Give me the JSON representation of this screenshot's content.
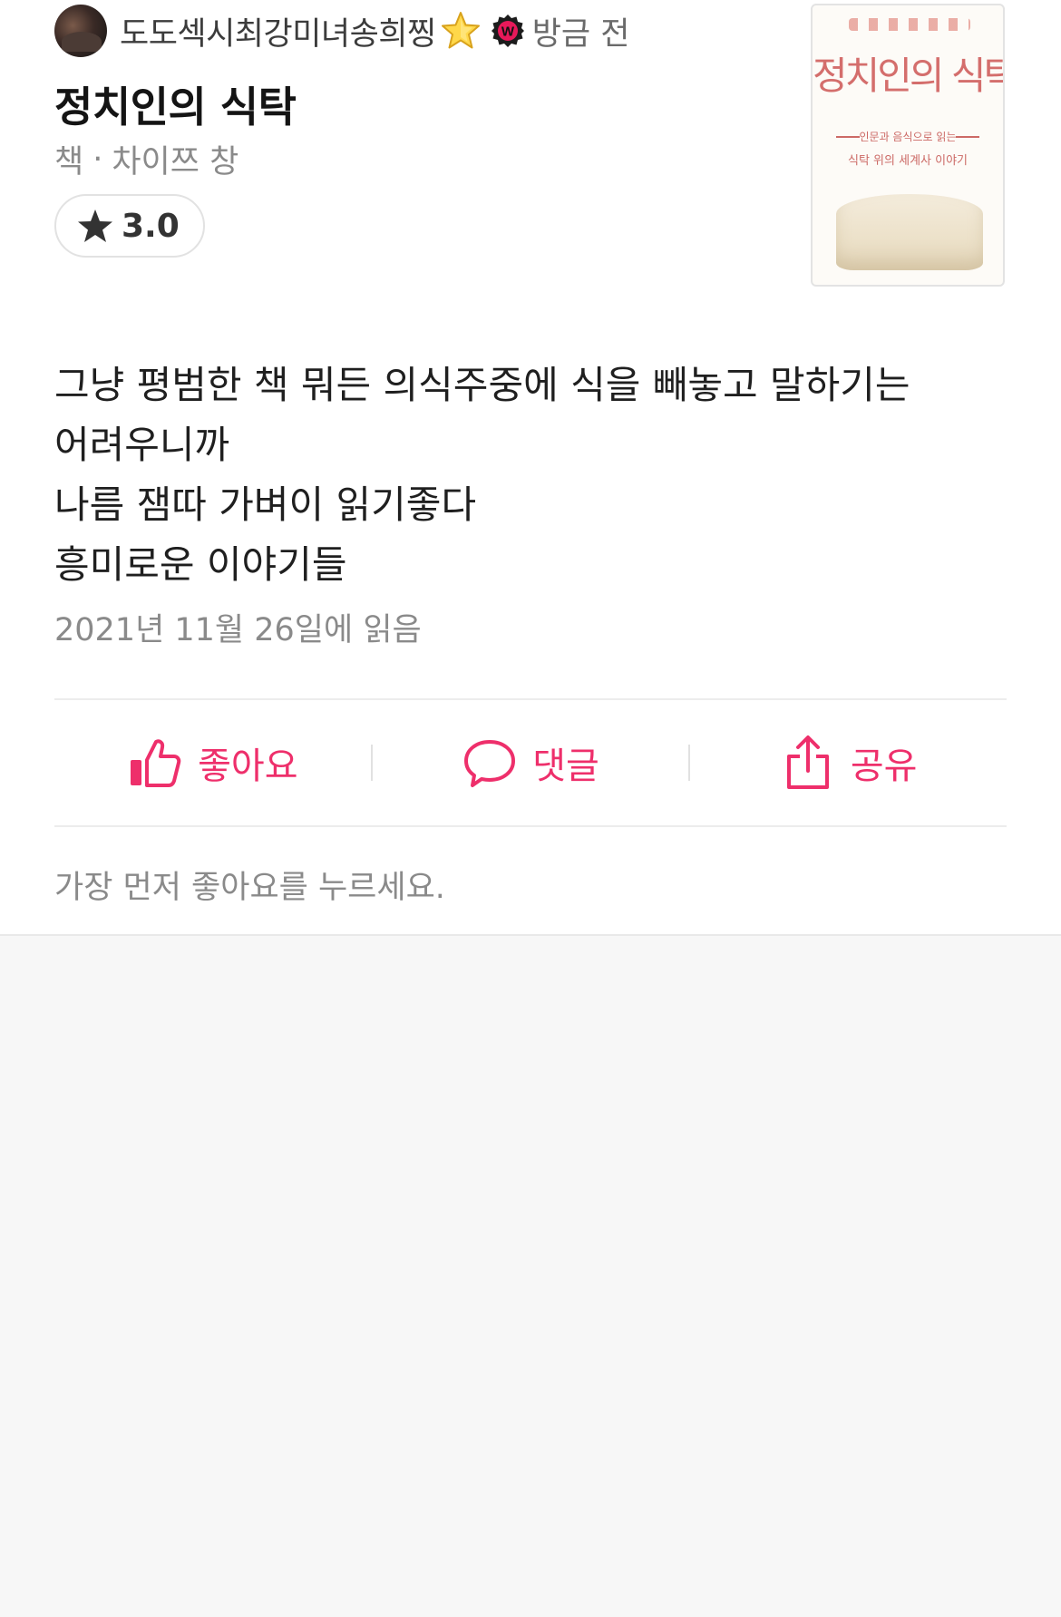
{
  "author": {
    "name": "도도섹시최강미녀송희찡",
    "name_emoji": "star-emoji",
    "badge_letter": "W",
    "time": "방금 전"
  },
  "book": {
    "title": "정치인의 식탁",
    "category": "책",
    "separator": "·",
    "author": "차이쯔 창",
    "rating": "3.0",
    "cover": {
      "title": "정치인의 식탁",
      "subtitle_1": "인문과 음식으로 읽는",
      "subtitle_2": "식탁 위의 세계사 이야기"
    }
  },
  "review": {
    "lines": [
      "그냥 평범한 책 뭐든 의식주중에 식을 빼놓고 말하기는",
      "어려우니까",
      "나름 잼따 가벼이 읽기좋다",
      "흥미로운 이야기들"
    ],
    "read_date": "2021년 11월 26일에 읽음"
  },
  "actions": {
    "like": "좋아요",
    "comment": "댓글",
    "share": "공유"
  },
  "like_hint": "가장 먼저 좋아요를 누르세요.",
  "colors": {
    "accent": "#ee2f6b",
    "badge": "#e8195a",
    "muted_text": "#8a8a8a",
    "background": "#f7f7f7"
  },
  "icons": {
    "rating": "star-icon",
    "like": "thumbs-up-icon",
    "comment": "speech-bubble-icon",
    "share": "share-icon",
    "badge": "watcha-badge-icon"
  }
}
